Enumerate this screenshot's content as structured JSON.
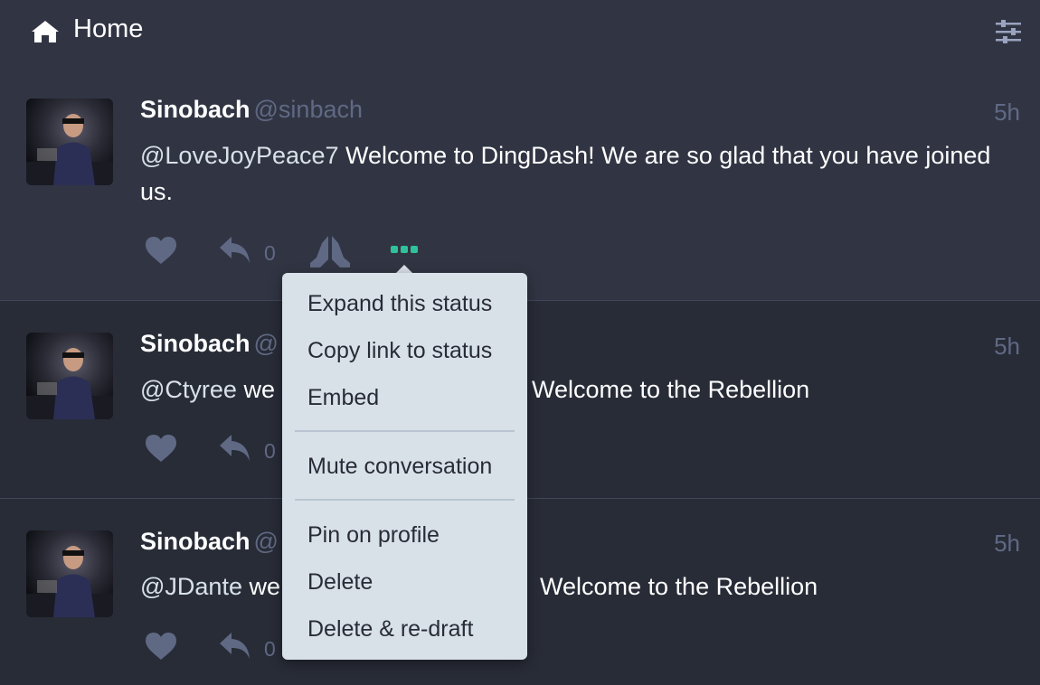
{
  "header": {
    "title": "Home",
    "home_icon": "home-icon",
    "settings_icon": "sliders-icon"
  },
  "statuses": [
    {
      "display_name": "Sinobach",
      "acct": "@sinbach",
      "time": "5h",
      "mention": "@LoveJoyPeace7",
      "text": " Welcome to DingDash!  We are so glad that you have joined us.",
      "reply_count": "0"
    },
    {
      "display_name": "Sinobach",
      "acct": "@",
      "time": "5h",
      "mention": "@Ctyree",
      "text_left": " we",
      "text_right": "Welcome to the Rebellion",
      "reply_count": "0"
    },
    {
      "display_name": "Sinobach",
      "acct": "@",
      "time": "5h",
      "mention": "@JDante",
      "text_left": " we",
      "text_right": "Welcome to the Rebellion",
      "reply_count": "0"
    }
  ],
  "menu": {
    "items": [
      "Expand this status",
      "Copy link to status",
      "Embed",
      "Mute conversation",
      "Pin on profile",
      "Delete",
      "Delete & re-draft"
    ]
  },
  "colors": {
    "background": "#282c37",
    "header_background": "#313543",
    "muted_text": "#606984",
    "menu_background": "#d9e1e8",
    "accent_green": "#2fc29a"
  }
}
